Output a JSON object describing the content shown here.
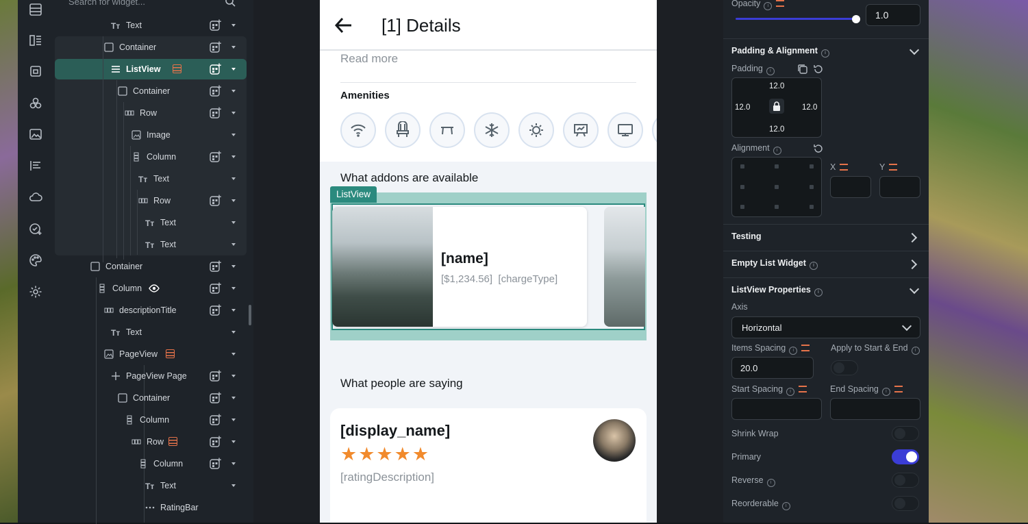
{
  "tree": {
    "search_placeholder": "Search for widget...",
    "rows": [
      {
        "label": "Text"
      },
      {
        "label": "Container"
      },
      {
        "label": "ListView"
      },
      {
        "label": "Container"
      },
      {
        "label": "Row"
      },
      {
        "label": "Image"
      },
      {
        "label": "Column"
      },
      {
        "label": "Text"
      },
      {
        "label": "Row"
      },
      {
        "label": "Text"
      },
      {
        "label": "Text"
      },
      {
        "label": "Container"
      },
      {
        "label": "Column"
      },
      {
        "label": "descriptionTitle"
      },
      {
        "label": "Text"
      },
      {
        "label": "PageView"
      },
      {
        "label": "PageView Page"
      },
      {
        "label": "Container"
      },
      {
        "label": "Column"
      },
      {
        "label": "Row"
      },
      {
        "label": "Column"
      },
      {
        "label": "Text"
      },
      {
        "label": "RatingBar"
      }
    ]
  },
  "device": {
    "title": "[1] Details",
    "read_more": "Read more",
    "amenities_title": "Amenities",
    "amenity_icons": [
      "wifi-icon",
      "chair-icon",
      "table-icon",
      "snowflake-icon",
      "sun-icon",
      "presentation-icon",
      "monitor-icon"
    ],
    "addons_title": "What addons are available",
    "listview_badge": "ListView",
    "card": {
      "name": "[name]",
      "price": "[$1,234.56]",
      "charge_type": "[chargeType]"
    },
    "people_title": "What people are saying",
    "review": {
      "display_name": "[display_name]",
      "stars": "★★★★★",
      "rating_description": "[ratingDescription]"
    }
  },
  "props": {
    "opacity_label": "Opacity",
    "opacity_value": "1.0",
    "padding_alignment_title": "Padding & Alignment",
    "padding_label": "Padding",
    "padding": {
      "top": "12.0",
      "left": "12.0",
      "right": "12.0",
      "bottom": "12.0"
    },
    "alignment_label": "Alignment",
    "x_label": "X",
    "y_label": "Y",
    "testing_title": "Testing",
    "empty_list_title": "Empty List Widget",
    "listview_props_title": "ListView Properties",
    "axis_label": "Axis",
    "axis_value": "Horizontal",
    "items_spacing_label": "Items Spacing",
    "items_spacing_value": "20.0",
    "apply_start_end_label": "Apply to Start & End",
    "start_spacing_label": "Start Spacing",
    "end_spacing_label": "End Spacing",
    "shrink_wrap_label": "Shrink Wrap",
    "primary_label": "Primary",
    "reverse_label": "Reverse",
    "reorderable_label": "Reorderable",
    "accent_color": "#3b3dd6",
    "selection_color": "#2b5e57"
  }
}
